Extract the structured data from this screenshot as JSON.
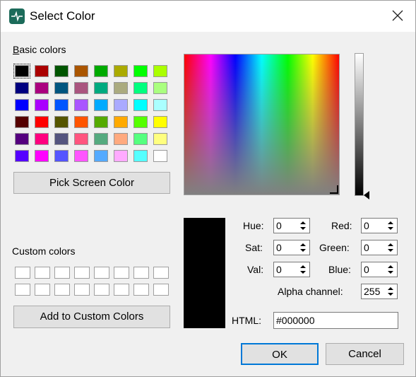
{
  "window": {
    "title": "Select Color",
    "icon": "app-icon",
    "close_icon": "close-icon"
  },
  "basic_colors": {
    "label": "Basic colors",
    "colors": [
      "#000000",
      "#aa0000",
      "#005500",
      "#aa5500",
      "#00aa00",
      "#aaaa00",
      "#00ff00",
      "#aaff00",
      "#00007f",
      "#aa007f",
      "#00557f",
      "#aa557f",
      "#00aa7f",
      "#aaaa7f",
      "#00ff7f",
      "#aaff7f",
      "#0000ff",
      "#aa00ff",
      "#0055ff",
      "#aa55ff",
      "#00aaff",
      "#aaaaff",
      "#00ffff",
      "#aaffff",
      "#550000",
      "#ff0000",
      "#555500",
      "#ff5500",
      "#55aa00",
      "#ffaa00",
      "#55ff00",
      "#ffff00",
      "#55007f",
      "#ff007f",
      "#55557f",
      "#ff557f",
      "#55aa7f",
      "#ffaa7f",
      "#55ff7f",
      "#ffff7f",
      "#5500ff",
      "#ff00ff",
      "#5555ff",
      "#ff55ff",
      "#55aaff",
      "#ffaaff",
      "#55ffff",
      "#ffffff"
    ],
    "selected_index": 0
  },
  "pick_screen_color_button": "Pick Screen Color",
  "custom_colors": {
    "label": "Custom colors",
    "count": 16
  },
  "add_custom_button": "Add to Custom Colors",
  "fields": {
    "hue": {
      "label": "Hue:",
      "value": "0"
    },
    "sat": {
      "label": "Sat:",
      "value": "0"
    },
    "val": {
      "label": "Val:",
      "value": "0"
    },
    "red": {
      "label": "Red:",
      "value": "0"
    },
    "green": {
      "label": "Green:",
      "value": "0"
    },
    "blue": {
      "label": "Blue:",
      "value": "0"
    },
    "alpha": {
      "label": "Alpha channel:",
      "value": "255"
    },
    "html": {
      "label": "HTML:",
      "value": "#000000"
    }
  },
  "current_color": "#000000",
  "ok_button": "OK",
  "cancel_button": "Cancel"
}
